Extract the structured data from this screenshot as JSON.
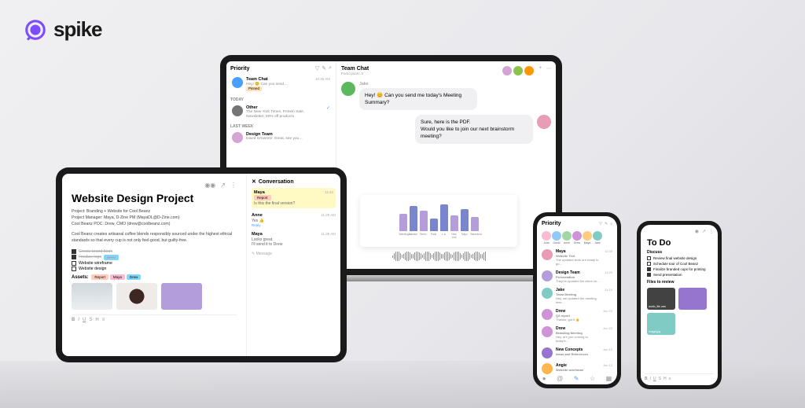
{
  "brand": {
    "name": "spike"
  },
  "laptop": {
    "left_header": "Priority",
    "sections": {
      "today": "TODAY",
      "last_week": "LAST WEEK"
    },
    "items": [
      {
        "name": "Team Chat",
        "sub": "Hey! 😊 Can you send…",
        "badge": "Pinned",
        "color": "#4a9eff",
        "time": "10:35 AM"
      },
      {
        "name": "Other",
        "sub": "The New York Times, Protein Sale, Newsletter, 50% off products",
        "color": "#757575",
        "time": ""
      },
      {
        "name": "Design Team",
        "sub": "David Growretz: Great, see you…",
        "color": "#d4a5d4",
        "time": ""
      }
    ],
    "chat_title": "Team Chat",
    "chat_sub": "Participants: 5",
    "avatars": [
      "#d4a5d4",
      "#8bc34a",
      "#ff9800"
    ],
    "messages": [
      {
        "name": "Jake",
        "text": "Hey! 😊 Can you send me today's Meeting Summary?",
        "avatar": "#5cb85c"
      },
      {
        "name": "",
        "text": "Sure, here is the PDF.\nWould you like to join our next brainstorm meeting?",
        "avatar": "#e89cb5",
        "right": true
      }
    ]
  },
  "chart_data": {
    "type": "bar",
    "categories": [
      "Washington",
      "London",
      "Berlin",
      "Paris",
      "L.A",
      "New York",
      "Tokyo",
      "Barcelona"
    ],
    "values": [
      55,
      80,
      65,
      40,
      85,
      50,
      70,
      45
    ],
    "colors": [
      "#b39ddb",
      "#7986cb",
      "#b39ddb",
      "#7986cb",
      "#7986cb",
      "#b39ddb",
      "#7986cb",
      "#b39ddb"
    ],
    "ylim": [
      0,
      100
    ]
  },
  "tablet": {
    "title": "Website Design Project",
    "meta": [
      "Project: Branding + Website for Cool Beanz",
      "Project Manager: Maya, D-Zine PM (MayaDL@D-Zine.com)",
      "Cool Beanz POC: Drew, CMO (drew@coolbeanz.com)"
    ],
    "desc": "Cool Beanz creates artisanal coffee blends responsibly sourced under the highest ethical standards so that every cup is not only feel-good, but guilty-free.",
    "todos": [
      {
        "label": "Create brand book",
        "done": true,
        "tag": null
      },
      {
        "label": "Finalize logo",
        "done": true,
        "tag": {
          "text": "Drew",
          "color": "#81d4fa"
        }
      },
      {
        "label": "Website wireframe",
        "done": false,
        "tag": null
      },
      {
        "label": "Website design",
        "done": false,
        "tag": null
      }
    ],
    "assets_label": "Assets:",
    "asset_tags": [
      {
        "text": "Report",
        "color": "#ffccbc"
      },
      {
        "text": "Maya",
        "color": "#f8bbd0"
      },
      {
        "text": "Drew",
        "color": "#81d4fa"
      }
    ],
    "conv_title": "Conversation",
    "conv": [
      {
        "name": "Maya",
        "time": "11:42",
        "msg": "Is this the final version?",
        "tag": {
          "text": "Report",
          "color": "#ffccbc"
        },
        "hl": true
      },
      {
        "name": "Anne",
        "time": "11:29 AM",
        "msg": "Yes 👍",
        "tag": null,
        "hl": false,
        "reply": true
      },
      {
        "name": "Maya",
        "time": "11:35 AM",
        "msg": "Looks great.\nI'll send it to Drew",
        "tag": null,
        "hl": false
      }
    ],
    "compose": "Message"
  },
  "phone1": {
    "header": "Priority",
    "faces": [
      {
        "n": "Julia",
        "c": "#f8bbd0"
      },
      {
        "n": "David",
        "c": "#90caf9"
      },
      {
        "n": "Anne",
        "c": "#a5d6a7"
      },
      {
        "n": "Drew",
        "c": "#ce93d8"
      },
      {
        "n": "Maya",
        "c": "#ffcc80"
      },
      {
        "n": "Jake",
        "c": "#80cbc4"
      }
    ],
    "items": [
      {
        "name": "Maya",
        "sub": "Website Text",
        "sub2": "The updated texts are ready to go…",
        "d": "11:35",
        "c": "#e89cb5"
      },
      {
        "name": "Design Team",
        "sub": "Presentation",
        "sub2": "They've updated the client on…",
        "d": "11:20",
        "c": "#b39ddb"
      },
      {
        "name": "Jake",
        "sub": "Team Meeting",
        "sub2": "Hey, we updated the meeting time…",
        "d": "11:10",
        "c": "#80cbc4"
      },
      {
        "name": "Drew",
        "sub": "Q3 report",
        "sub2": "Thanks, got it 👍",
        "d": "Jun 23",
        "c": "#ce93d8"
      },
      {
        "name": "Drew",
        "sub": "Branding Meeting",
        "sub2": "Hey, are you coming to today's…",
        "d": "Jun 23",
        "c": "#ce93d8"
      },
      {
        "name": "New Concepts",
        "sub": "Ideas and References",
        "sub2": "",
        "d": "Jun 12",
        "c": "#9575cd"
      },
      {
        "name": "Angie",
        "sub": "Website wireframe",
        "sub2": "",
        "d": "Jun 12",
        "c": "#ffb74d"
      }
    ]
  },
  "phone2": {
    "title": "To Do",
    "section1": "Discuss",
    "todos": [
      {
        "label": "Review final website design",
        "done": false
      },
      {
        "label": "Schedule tour of Cool Beanz",
        "done": false
      },
      {
        "label": "Finalize branded cups for printing",
        "done": true
      },
      {
        "label": "Send presentation",
        "done": true
      }
    ],
    "section2": "Files to review",
    "files": [
      {
        "name": "audio_file.wav",
        "color": "#424242"
      },
      {
        "name": "",
        "color": "#9575cd"
      },
      {
        "name": "image.jpg",
        "color": "#80cbc4"
      }
    ]
  }
}
